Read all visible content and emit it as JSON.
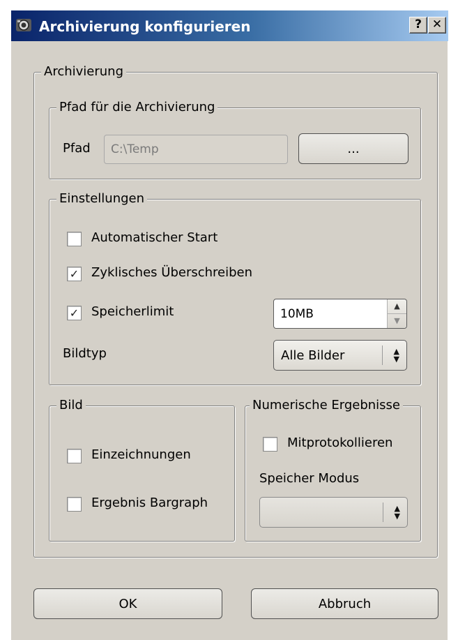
{
  "window": {
    "title": "Archivierung konfigurieren",
    "help_label": "?",
    "close_label": "✕"
  },
  "archivierung": {
    "legend": "Archivierung",
    "pfad_group": {
      "legend": "Pfad für die Archivierung",
      "pfad_label": "Pfad",
      "pfad_value": "C:\\Temp",
      "browse_label": "..."
    },
    "einstellungen": {
      "legend": "Einstellungen",
      "auto_start": {
        "label": "Automatischer Start",
        "checked": false
      },
      "zyklisch": {
        "label": "Zyklisches Überschreiben",
        "checked": true
      },
      "speicherlimit": {
        "label": "Speicherlimit",
        "checked": true,
        "value": "10MB"
      },
      "bildtyp_label": "Bildtyp",
      "bildtyp_value": "Alle Bilder"
    },
    "bild": {
      "legend": "Bild",
      "einzeichnungen": {
        "label": "Einzeichnungen",
        "checked": false
      },
      "bargraph": {
        "label": "Ergebnis Bargraph",
        "checked": false
      }
    },
    "numerisch": {
      "legend": "Numerische Ergebnisse",
      "mitprotokollieren": {
        "label": "Mitprotokollieren",
        "checked": false
      },
      "speicher_modus_label": "Speicher Modus",
      "speicher_modus_value": ""
    }
  },
  "buttons": {
    "ok": "OK",
    "cancel": "Abbruch"
  },
  "check_glyph": "✓"
}
